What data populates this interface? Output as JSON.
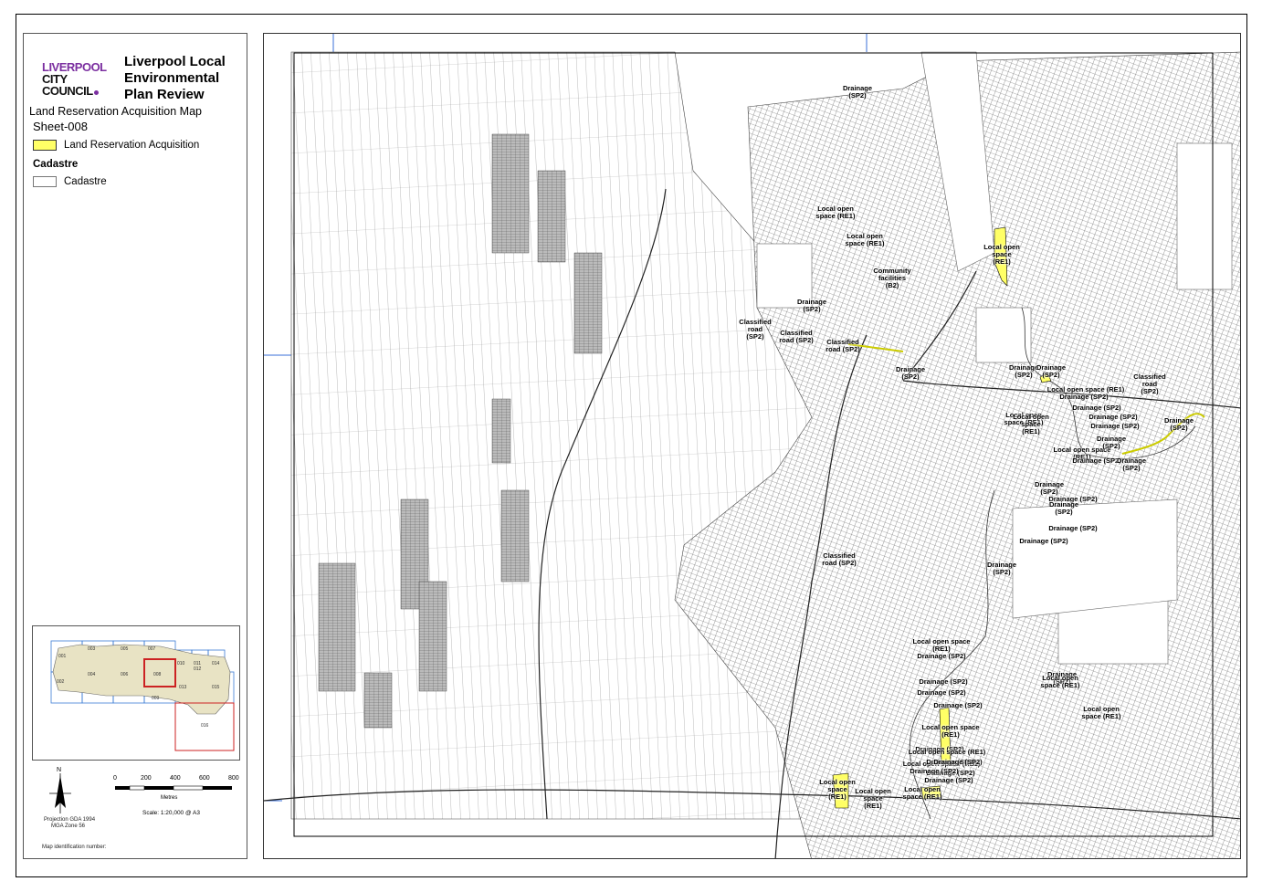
{
  "header": {
    "council_line1": "LIVERPOOL",
    "council_line2": "CITY",
    "council_line3": "COUNCIL",
    "title": "Liverpool Local Environmental Plan Review",
    "map_title": "Land Reservation Acquisition Map",
    "sheet": "Sheet-008"
  },
  "legend": {
    "items": [
      {
        "label": "Land Reservation Acquisition",
        "color": "#ffff66"
      }
    ],
    "section": "Cadastre",
    "cadastre_label": "Cadastre"
  },
  "inset": {
    "sheets": [
      "001",
      "002",
      "003",
      "004",
      "005",
      "006",
      "007",
      "008",
      "009",
      "010",
      "011",
      "012",
      "013",
      "014",
      "015",
      "016"
    ],
    "highlight": "008"
  },
  "scale": {
    "ticks": [
      "0",
      "200",
      "400",
      "600",
      "800"
    ],
    "unit": "Metres",
    "text": "Scale: 1:20,000 @ A3",
    "north": "N"
  },
  "footer": {
    "projection": "Projection GDA 1994",
    "zone": "MGA Zone 56",
    "map_id": "Map identification number:"
  },
  "map_labels": [
    {
      "text": "Drainage\n(SP2)"
    },
    {
      "text": "Local open\nspace (RE1)"
    },
    {
      "text": "Local open\nspace (RE1)"
    },
    {
      "text": "Local open\nspace\n(RE1)"
    },
    {
      "text": "Community\nfacilities\n(B2)"
    },
    {
      "text": "Drainage\n(SP2)"
    },
    {
      "text": "Classified\nroad\n(SP2)"
    },
    {
      "text": "Classified\nroad (SP2)"
    },
    {
      "text": "Classified\nroad (SP2)"
    },
    {
      "text": "Drainage\n(SP2)"
    },
    {
      "text": "Drainage\n(SP2)"
    },
    {
      "text": "Drainage\n(SP2)"
    },
    {
      "text": "Local open space (RE1)"
    },
    {
      "text": "Drainage (SP2)"
    },
    {
      "text": "Drainage (SP2)"
    },
    {
      "text": "Classified\nroad\n(SP2)"
    },
    {
      "text": "Drainage\n(SP2)"
    },
    {
      "text": "Local open\nspace (RE1)"
    },
    {
      "text": "Drainage (SP2)"
    },
    {
      "text": "Drainage (SP2)"
    },
    {
      "text": "Local open\nspace\n(RE1)"
    },
    {
      "text": "Local open space\n(RE1)"
    },
    {
      "text": "Drainage\n(SP2)"
    },
    {
      "text": "Drainage (SP2)"
    },
    {
      "text": "Drainage\n(SP2)"
    },
    {
      "text": "Drainage\n(SP2)"
    },
    {
      "text": "Drainage (SP2)"
    },
    {
      "text": "Drainage\n(SP2)"
    },
    {
      "text": "Drainage (SP2)"
    },
    {
      "text": "Drainage (SP2)"
    },
    {
      "text": "Drainage\n(SP2)"
    },
    {
      "text": "Classified\nroad (SP2)"
    },
    {
      "text": "Drainage\n(SP2)"
    },
    {
      "text": "Local open space\n(RE1)"
    },
    {
      "text": "Drainage (SP2)"
    },
    {
      "text": "Local open\nspace (RE1)"
    },
    {
      "text": "Drainage (SP2)"
    },
    {
      "text": "Drainage (SP2)"
    },
    {
      "text": "Drainage (SP2)"
    },
    {
      "text": "Local open space\n(RE1)"
    },
    {
      "text": "Local open\nspace (RE1)"
    },
    {
      "text": "Drainage (SP2)"
    },
    {
      "text": "Local open space (RE1)"
    },
    {
      "text": "Drainage (SP2)"
    },
    {
      "text": "Drainage (SP2)"
    },
    {
      "text": "Drainage (SP2)"
    },
    {
      "text": "Local open space (RE1)"
    },
    {
      "text": "Drainage (SP2)"
    },
    {
      "text": "Drainage (SP2)"
    },
    {
      "text": "Local open\nspace\n(RE1)"
    },
    {
      "text": "Local open\nspace\n(RE1)"
    },
    {
      "text": "Local open\nspace (RE1)"
    }
  ]
}
